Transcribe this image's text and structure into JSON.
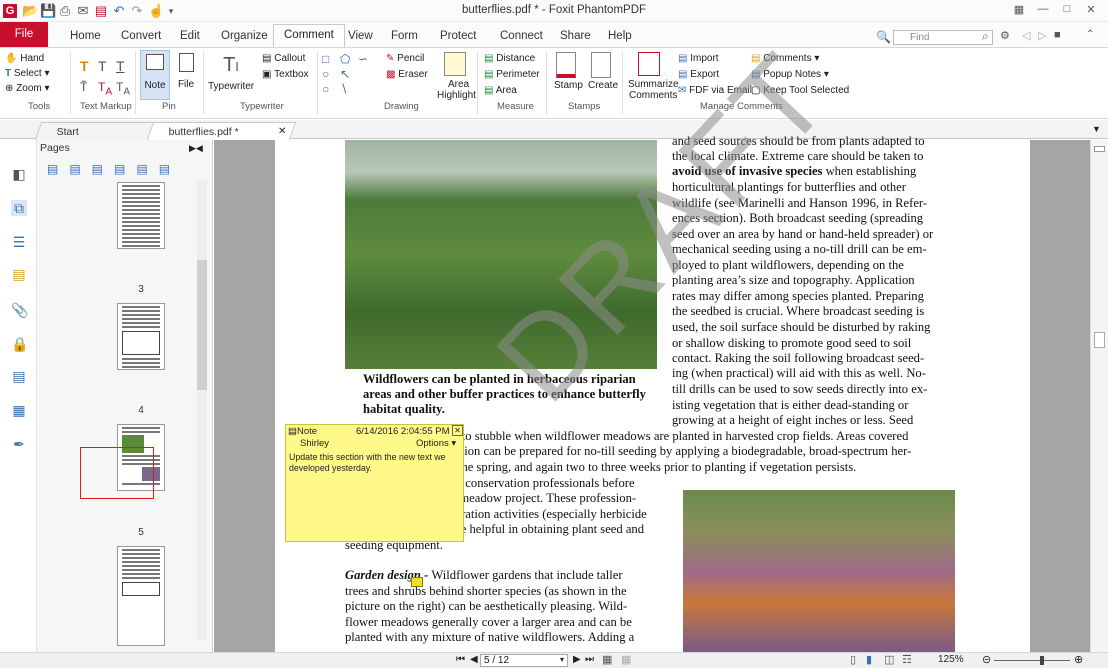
{
  "window": {
    "title": "butterflies.pdf * - Foxit PhantomPDF"
  },
  "tabs": {
    "file": "File",
    "home": "Home",
    "convert": "Convert",
    "edit": "Edit",
    "organize": "Organize",
    "comment": "Comment",
    "view": "View",
    "form": "Form",
    "protect": "Protect",
    "connect": "Connect",
    "share": "Share",
    "help": "Help"
  },
  "search": {
    "placeholder": "Find"
  },
  "ribbon": {
    "tools": {
      "hand": "Hand",
      "select": "Select",
      "zoom": "Zoom",
      "group": "Tools"
    },
    "textmarkup": {
      "group": "Text Markup"
    },
    "pin": {
      "note": "Note",
      "file": "File",
      "group": "Pin"
    },
    "typewriter": {
      "typewriter": "Typewriter",
      "callout": "Callout",
      "textbox": "Textbox",
      "group": "Typewriter"
    },
    "drawing": {
      "pencil": "Pencil",
      "eraser": "Eraser",
      "area_highlight_1": "Area",
      "area_highlight_2": "Highlight",
      "group": "Drawing"
    },
    "measure": {
      "distance": "Distance",
      "perimeter": "Perimeter",
      "area": "Area",
      "group": "Measure"
    },
    "stamps": {
      "stamp": "Stamp",
      "create": "Create",
      "group": "Stamps"
    },
    "manage": {
      "summarize_1": "Summarize",
      "summarize_2": "Comments",
      "import": "Import",
      "export": "Export",
      "fdf": "FDF via Email",
      "comments": "Comments",
      "popup": "Popup Notes",
      "keep": "Keep Tool Selected",
      "group": "Manage Comments"
    }
  },
  "doctabs": {
    "start": "Start",
    "file": "butterflies.pdf *"
  },
  "panel": {
    "title": "Pages",
    "page_numbers": [
      "3",
      "4",
      "5"
    ]
  },
  "note": {
    "title": "Note",
    "timestamp": "6/14/2016 2:04:55 PM",
    "author": "Shirley",
    "options": "Options",
    "text_1": "Update this section with the new text we",
    "text_2": "developed yesterday."
  },
  "watermark": "DRAFT",
  "doc": {
    "right_col": [
      "and seed sources should be from plants adapted to",
      "the local climate.  Extreme care should be taken to",
      "avoid use of invasive species",
      "horticultural plantings for butterflies and other",
      "wildlife (see Marinelli and Hanson 1996, in Refer-",
      "ences section).  Both broadcast seeding (spreading",
      "seed over an area by hand or hand-held spreader) or",
      "mechanical seeding using a no-till drill can be em-",
      "ployed to plant wildflowers, depending on the",
      "planting area’s size and topography.  Application",
      "rates may differ among species planted.  Preparing",
      "the seedbed is crucial.  Where broadcast seeding is",
      "used, the soil surface should be disturbed by raking",
      "or shallow disking to promote good seed to soil",
      "contact.  Raking the soil following broadcast seed-",
      "ing (when practical) will aid with this as well.  No-",
      "till drills can be used to sow seeds directly into ex-",
      "isting vegetation that is either dead-standing or",
      "growing at a height of eight inches or less.  Seed"
    ],
    "line2_rest": " when establishing",
    "caption": [
      "Wildflowers can be planted in herbaceous riparian",
      "areas and other buffer practices to enhance butterfly",
      "habitat quality."
    ],
    "full_lines": [
      "can be sown directly into stubble when wildflower meadows are planted in harvested crop fields.  Areas covered",
      "by dense grassy vegetation can be prepared for no-till seeding by applying a biodegradable, broad-spectrum her-",
      "bicide (glyphosate) in the spring, and again two to three weeks prior to planting if vegetation persists."
    ],
    "left_col": [
      "Consult federal or state conservation professionals before",
      "planning a wildflower meadow project.  These profession-",
      "als can help with preparation activities (especially herbicide",
      "application) and may be helpful in obtaining plant seed and",
      "seeding equipment."
    ],
    "garden_head": "Garden design - ",
    "garden": [
      "Wildflower gardens that include taller",
      "trees and shrubs behind shorter species (as shown in the",
      "picture on the right) can be aesthetically pleasing.  Wild-",
      "flower meadows generally cover a larger area and can be",
      "planted with any mixture of native wildflowers.  Adding a"
    ]
  },
  "status": {
    "page": "5 / 12",
    "zoom": "125%"
  }
}
